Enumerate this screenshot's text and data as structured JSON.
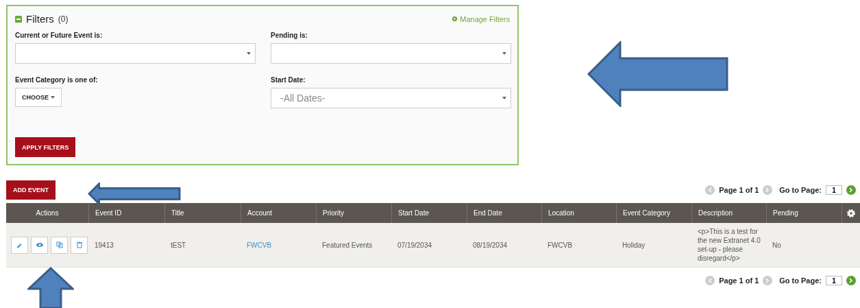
{
  "filters": {
    "title": "Filters",
    "count": "(0)",
    "expanded": true,
    "manage_link": "Manage Filters",
    "fields": [
      {
        "kind": "select",
        "label": "Current or Future Event is:"
      },
      {
        "kind": "select",
        "label": "Pending is:"
      },
      {
        "kind": "choose",
        "label": "Event Category is one of:",
        "button": "CHOOSE"
      },
      {
        "kind": "select",
        "label": "Start Date:",
        "value": "-All Dates-"
      }
    ],
    "apply_button": "APPLY FILTERS"
  },
  "add_button": "ADD EVENT",
  "pagination_top": {
    "page_text": "Page 1 of 1",
    "goto_label": "Go to Page:",
    "page_value": "1"
  },
  "table": {
    "columns": [
      "Actions",
      "Event ID",
      "Title",
      "Account",
      "Priority",
      "Start Date",
      "End Date",
      "Location",
      "Event Category",
      "Description",
      "Pending"
    ],
    "rows": [
      {
        "cells": [
          {
            "kind": "actions",
            "actions": [
              {
                "kind": "edit"
              },
              {
                "kind": "view"
              },
              {
                "kind": "copy"
              },
              {
                "kind": "delete"
              }
            ]
          },
          {
            "kind": "text",
            "text": "19413"
          },
          {
            "kind": "text",
            "text": "tEST"
          },
          {
            "kind": "link",
            "text": "FWCVB"
          },
          {
            "kind": "text",
            "text": "Featured Events"
          },
          {
            "kind": "text",
            "text": "07/19/2034"
          },
          {
            "kind": "text",
            "text": "08/19/2034"
          },
          {
            "kind": "text",
            "text": "FWCVB"
          },
          {
            "kind": "text",
            "text": "Holiday"
          },
          {
            "kind": "text",
            "text": "<p>This is a test for the new Extranet 4.0 set-up - please disregard</p>"
          },
          {
            "kind": "text",
            "text": "No"
          }
        ]
      }
    ]
  },
  "pagination_bottom": {
    "page_text": "Page 1 of 1",
    "goto_label": "Go to Page:",
    "page_value": "1"
  }
}
